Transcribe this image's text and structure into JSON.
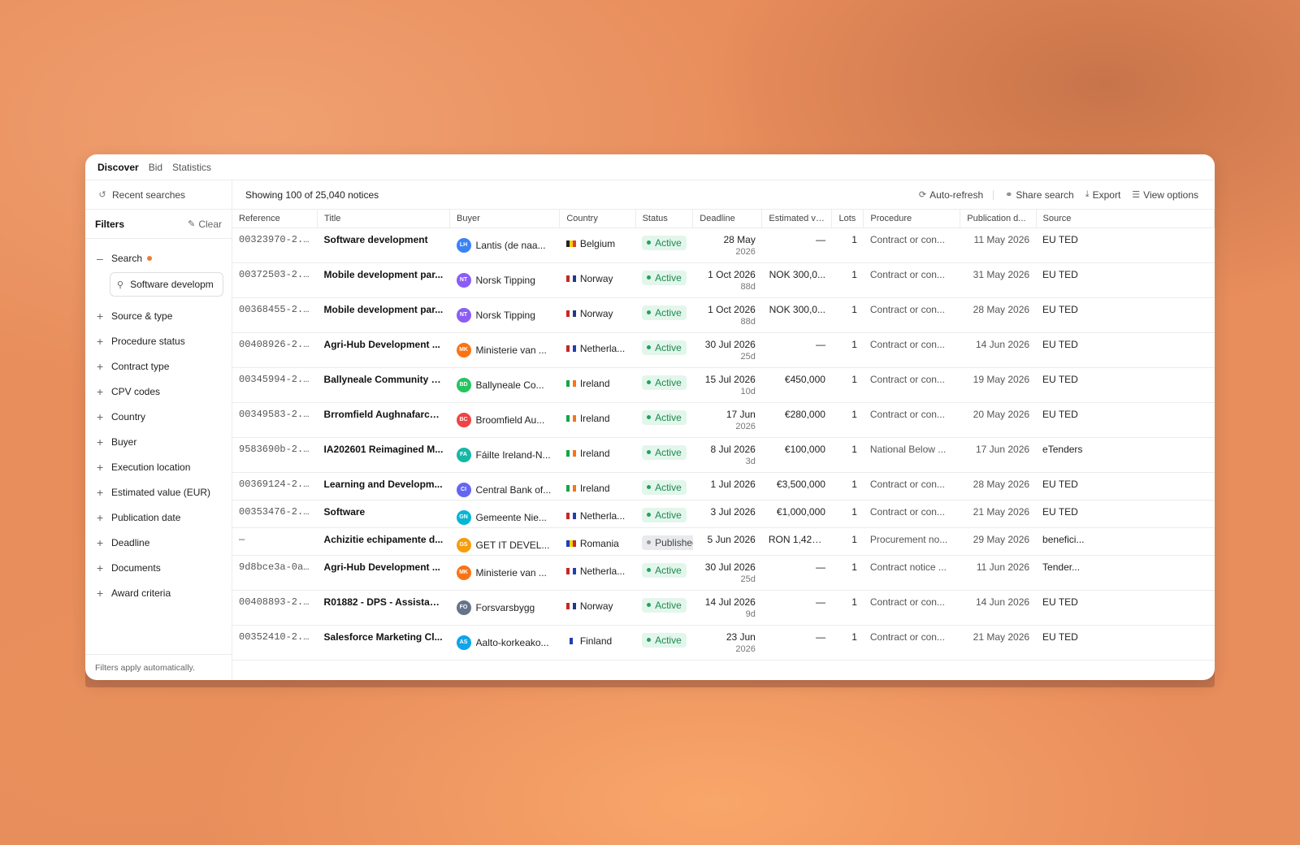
{
  "nav": {
    "tabs": [
      "Discover",
      "Bid",
      "Statistics"
    ]
  },
  "sidebar": {
    "recent_label": "Recent searches",
    "filters_title": "Filters",
    "clear_label": "Clear",
    "search_label": "Search",
    "search_value": "Software developm",
    "filters": [
      "Source & type",
      "Procedure status",
      "Contract type",
      "CPV codes",
      "Country",
      "Buyer",
      "Execution location",
      "Estimated value (EUR)",
      "Publication date",
      "Deadline",
      "Documents",
      "Award criteria"
    ],
    "footer": "Filters apply automatically."
  },
  "toolbar": {
    "count_text": "Showing 100 of 25,040 notices",
    "auto_refresh": "Auto-refresh",
    "share": "Share search",
    "export": "Export",
    "view_options": "View options"
  },
  "table": {
    "headers": [
      "Reference",
      "Title",
      "Buyer",
      "Country",
      "Status",
      "Deadline",
      "Estimated va...",
      "Lots",
      "Procedure",
      "Publication d...",
      "Source"
    ],
    "rows": [
      {
        "ref": "00323970-2...",
        "title": "Software development",
        "initials": "LH",
        "color": "#3b82f6",
        "buyer": "Lantis (de naa...",
        "flag": [
          "#222",
          "#f5d000",
          "#e53935"
        ],
        "country": "Belgium",
        "status": "Active",
        "deadline": "28 May",
        "deadline_sub": "2026",
        "value": "—",
        "lots": "1",
        "procedure": "Contract or con...",
        "published": "11 May 2026",
        "source": "EU TED"
      },
      {
        "ref": "00372503-2...",
        "title": "Mobile development par...",
        "initials": "NT",
        "color": "#8b5cf6",
        "buyer": "Norsk Tipping",
        "flag": [
          "#c62828",
          "#ffffff",
          "#1e3a8a"
        ],
        "country": "Norway",
        "status": "Active",
        "deadline": "1 Oct 2026",
        "deadline_sub": "88d",
        "value": "NOK 300,0...",
        "lots": "1",
        "procedure": "Contract or con...",
        "published": "31 May 2026",
        "source": "EU TED"
      },
      {
        "ref": "00368455-2...",
        "title": "Mobile development par...",
        "initials": "NT",
        "color": "#8b5cf6",
        "buyer": "Norsk Tipping",
        "flag": [
          "#c62828",
          "#ffffff",
          "#1e3a8a"
        ],
        "country": "Norway",
        "status": "Active",
        "deadline": "1 Oct 2026",
        "deadline_sub": "88d",
        "value": "NOK 300,0...",
        "lots": "1",
        "procedure": "Contract or con...",
        "published": "28 May 2026",
        "source": "EU TED"
      },
      {
        "ref": "00408926-2...",
        "title": "Agri-Hub Development ...",
        "initials": "MK",
        "color": "#f97316",
        "buyer": "Ministerie van ...",
        "flag": [
          "#c62828",
          "#ffffff",
          "#1e40af"
        ],
        "country": "Netherla...",
        "status": "Active",
        "deadline": "30 Jul 2026",
        "deadline_sub": "25d",
        "value": "—",
        "lots": "1",
        "procedure": "Contract or con...",
        "published": "14 Jun 2026",
        "source": "EU TED"
      },
      {
        "ref": "00345994-2...",
        "title": "Ballyneale Community D...",
        "initials": "BD",
        "color": "#22c55e",
        "buyer": "Ballyneale Co...",
        "flag": [
          "#16a34a",
          "#ffffff",
          "#f97316"
        ],
        "country": "Ireland",
        "status": "Active",
        "deadline": "15 Jul 2026",
        "deadline_sub": "10d",
        "value": "€450,000",
        "lots": "1",
        "procedure": "Contract or con...",
        "published": "19 May 2026",
        "source": "EU TED"
      },
      {
        "ref": "00349583-2...",
        "title": "Brromfield Aughnafarco...",
        "initials": "BC",
        "color": "#ef4444",
        "buyer": "Broomfield Au...",
        "flag": [
          "#16a34a",
          "#ffffff",
          "#f97316"
        ],
        "country": "Ireland",
        "status": "Active",
        "deadline": "17 Jun",
        "deadline_sub": "2026",
        "value": "€280,000",
        "lots": "1",
        "procedure": "Contract or con...",
        "published": "20 May 2026",
        "source": "EU TED"
      },
      {
        "ref": "9583690b-2...",
        "title": "IA202601 Reimagined M...",
        "initials": "FA",
        "color": "#14b8a6",
        "buyer": "Fáilte Ireland-N...",
        "flag": [
          "#16a34a",
          "#ffffff",
          "#f97316"
        ],
        "country": "Ireland",
        "status": "Active",
        "deadline": "8 Jul 2026",
        "deadline_sub": "3d",
        "value": "€100,000",
        "lots": "1",
        "procedure": "National Below ...",
        "published": "17 Jun 2026",
        "source": "eTenders"
      },
      {
        "ref": "00369124-2...",
        "title": "Learning and Developm...",
        "initials": "CI",
        "color": "#6366f1",
        "buyer": "Central Bank of...",
        "flag": [
          "#16a34a",
          "#ffffff",
          "#f97316"
        ],
        "country": "Ireland",
        "status": "Active",
        "deadline": "1 Jul 2026",
        "deadline_sub": "",
        "value": "€3,500,000",
        "lots": "1",
        "procedure": "Contract or con...",
        "published": "28 May 2026",
        "source": "EU TED"
      },
      {
        "ref": "00353476-2...",
        "title": "Software",
        "initials": "GN",
        "color": "#06b6d4",
        "buyer": "Gemeente Nie...",
        "flag": [
          "#c62828",
          "#ffffff",
          "#1e40af"
        ],
        "country": "Netherla...",
        "status": "Active",
        "deadline": "3 Jul 2026",
        "deadline_sub": "",
        "value": "€1,000,000",
        "lots": "1",
        "procedure": "Contract or con...",
        "published": "21 May 2026",
        "source": "EU TED"
      },
      {
        "ref": "—",
        "title": "Achizitie echipamente d...",
        "initials": "GS",
        "color": "#f59e0b",
        "buyer": "GET IT DEVEL...",
        "flag": [
          "#1e40af",
          "#f5d000",
          "#c62828"
        ],
        "country": "Romania",
        "status": "Published",
        "deadline": "5 Jun 2026",
        "deadline_sub": "",
        "value": "RON 1,423,...",
        "lots": "1",
        "procedure": "Procurement no...",
        "published": "29 May 2026",
        "source": "benefici..."
      },
      {
        "ref": "9d8bce3a-0a...",
        "title": "Agri-Hub Development ...",
        "initials": "MK",
        "color": "#f97316",
        "buyer": "Ministerie van ...",
        "flag": [
          "#c62828",
          "#ffffff",
          "#1e40af"
        ],
        "country": "Netherla...",
        "status": "Active",
        "deadline": "30 Jul 2026",
        "deadline_sub": "25d",
        "value": "—",
        "lots": "1",
        "procedure": "Contract notice ...",
        "published": "11 Jun 2026",
        "source": "Tender..."
      },
      {
        "ref": "00408893-2...",
        "title": "R01882 - DPS - Assistan...",
        "initials": "FO",
        "color": "#64748b",
        "buyer": "Forsvarsbygg",
        "flag": [
          "#c62828",
          "#ffffff",
          "#1e3a8a"
        ],
        "country": "Norway",
        "status": "Active",
        "deadline": "14 Jul 2026",
        "deadline_sub": "9d",
        "value": "—",
        "lots": "1",
        "procedure": "Contract or con...",
        "published": "14 Jun 2026",
        "source": "EU TED"
      },
      {
        "ref": "00352410-2...",
        "title": "Salesforce Marketing Cl...",
        "initials": "AS",
        "color": "#0ea5e9",
        "buyer": "Aalto-korkeako...",
        "flag": [
          "#ffffff",
          "#1e40af",
          "#ffffff"
        ],
        "country": "Finland",
        "status": "Active",
        "deadline": "23 Jun",
        "deadline_sub": "2026",
        "value": "—",
        "lots": "1",
        "procedure": "Contract or con...",
        "published": "21 May 2026",
        "source": "EU TED"
      }
    ]
  }
}
